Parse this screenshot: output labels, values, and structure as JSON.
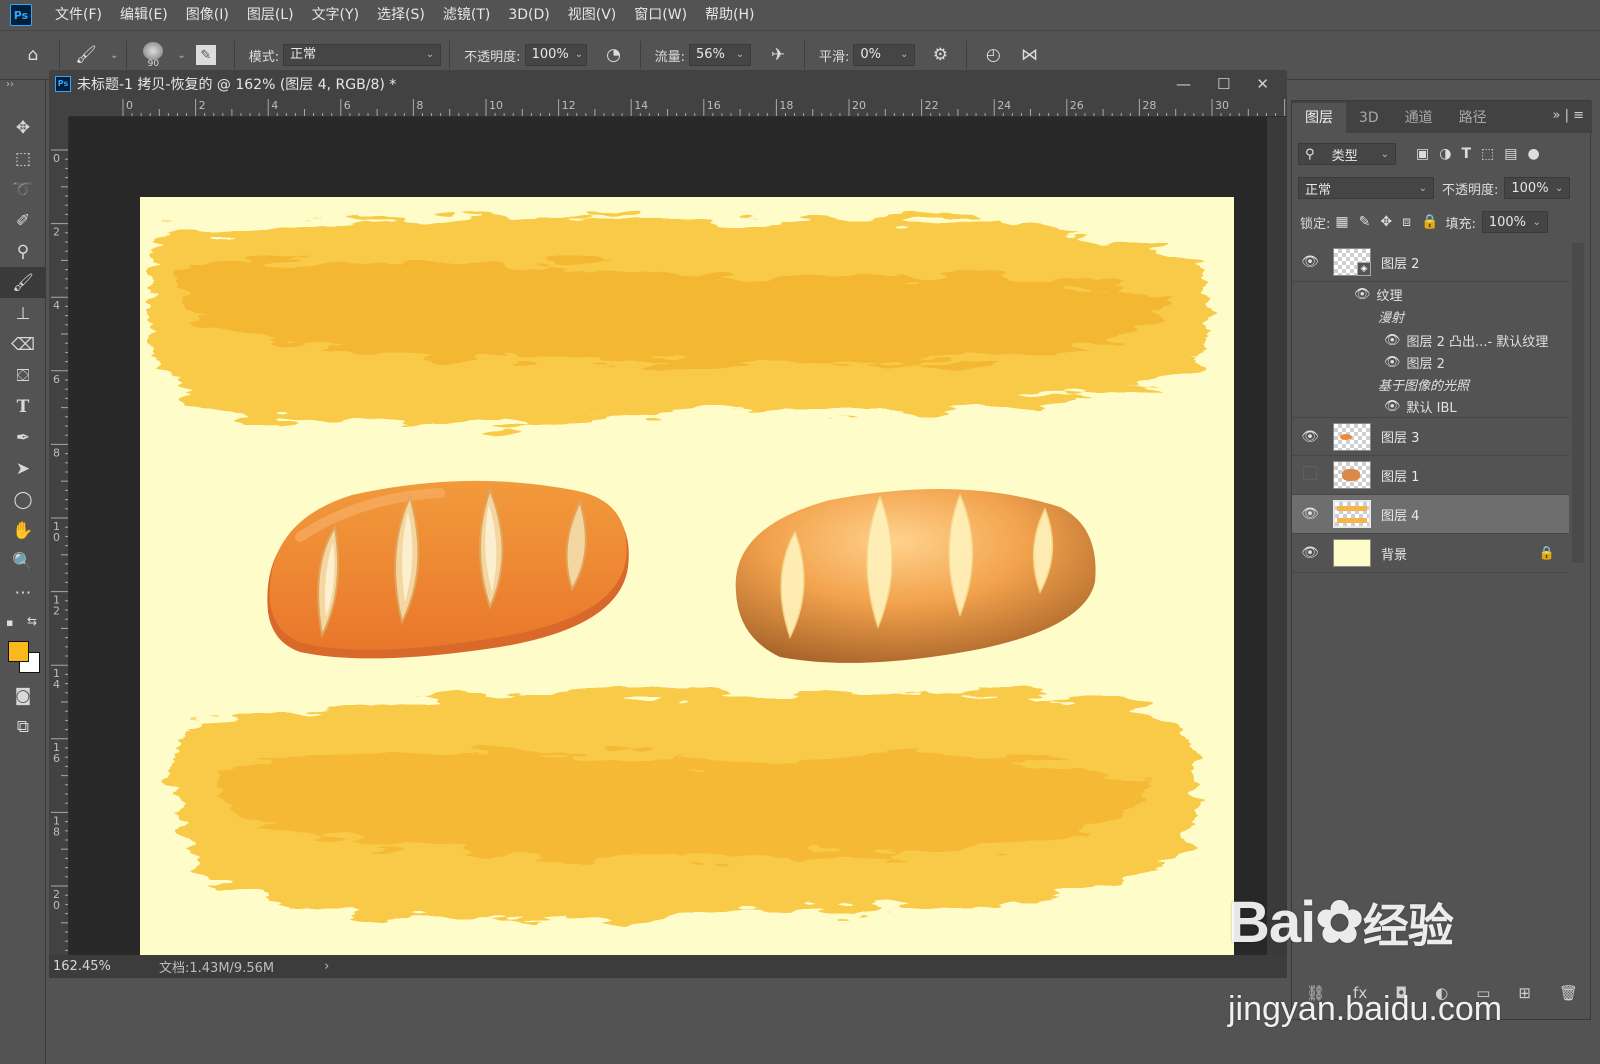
{
  "menubar": {
    "logo": "Ps",
    "items": [
      "文件(F)",
      "编辑(E)",
      "图像(I)",
      "图层(L)",
      "文字(Y)",
      "选择(S)",
      "滤镜(T)",
      "3D(D)",
      "视图(V)",
      "窗口(W)",
      "帮助(H)"
    ]
  },
  "options": {
    "mode_label": "模式:",
    "mode_value": "正常",
    "opacity_label": "不透明度:",
    "opacity_value": "100%",
    "flow_label": "流量:",
    "flow_value": "56%",
    "smooth_label": "平滑:",
    "smooth_value": "0%",
    "brush_size": "90"
  },
  "document": {
    "title": "未标题-1 拷贝-恢复的 @ 162% (图层 4, RGB/8) *",
    "zoom": "162.45%",
    "doc_info": "文档:1.43M/9.56M",
    "ruler_h": [
      "0",
      "2",
      "4",
      "6",
      "8",
      "10",
      "12",
      "14",
      "16",
      "18",
      "20",
      "22",
      "24",
      "26",
      "28",
      "30"
    ],
    "ruler_v": [
      "0",
      "2",
      "4",
      "6",
      "8",
      "10",
      "12",
      "14",
      "16",
      "18",
      "20"
    ]
  },
  "colors": {
    "foreground": "#f9b81b",
    "background": "#ffffff",
    "canvas_bg": "#fefcc9"
  },
  "panel": {
    "tabs": [
      "图层",
      "3D",
      "通道",
      "路径"
    ],
    "filter_label": "类型",
    "blend_mode": "正常",
    "opacity_label": "不透明度:",
    "opacity_value": "100%",
    "lock_label": "锁定:",
    "fill_label": "填充:",
    "fill_value": "100%",
    "layers": [
      {
        "name": "图层 2",
        "visible": true
      },
      {
        "name": "图层 3",
        "visible": true
      },
      {
        "name": "图层 1",
        "visible": false
      },
      {
        "name": "图层 4",
        "visible": true,
        "selected": true
      },
      {
        "name": "背景",
        "visible": true,
        "locked": true
      }
    ],
    "sublayers": {
      "texture": "纹理",
      "diffuse": "漫射",
      "diffuse_item1": "图层 2 凸出...- 默认纹理",
      "diffuse_item2": "图层 2",
      "ibl_group": "基于图像的光照",
      "ibl_item": "默认 IBL"
    }
  },
  "watermark": {
    "brand": "Bai",
    "brand2": "经验",
    "url": "jingyan.baidu.com"
  }
}
